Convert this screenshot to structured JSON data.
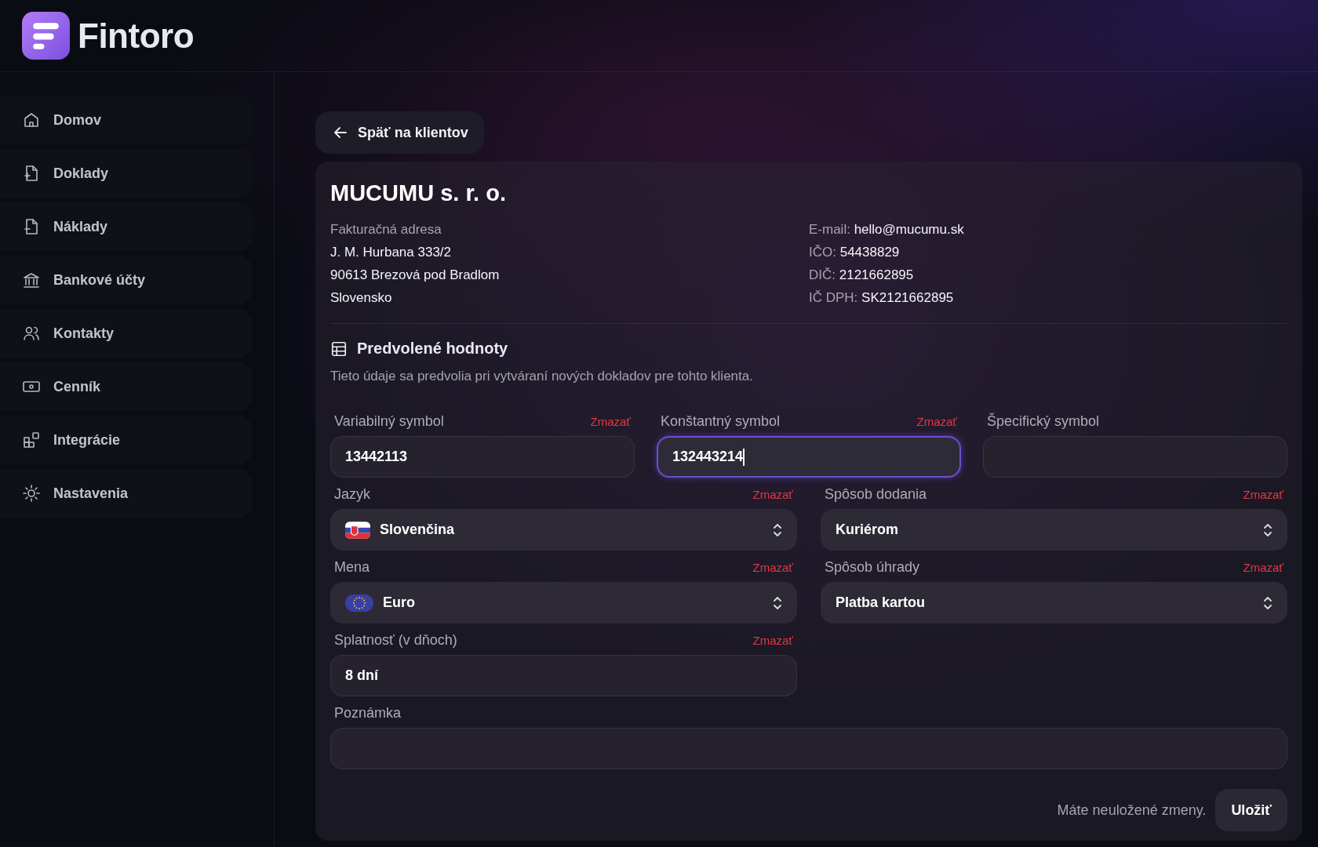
{
  "app": {
    "name": "Fintoro"
  },
  "sidebar": {
    "items": [
      {
        "label": "Domov"
      },
      {
        "label": "Doklady"
      },
      {
        "label": "Náklady"
      },
      {
        "label": "Bankové účty"
      },
      {
        "label": "Kontakty"
      },
      {
        "label": "Cenník"
      },
      {
        "label": "Integrácie"
      },
      {
        "label": "Nastavenia"
      }
    ]
  },
  "back_button": "Späť na klientov",
  "client": {
    "name": "MUCUMU s. r. o.",
    "address_label": "Fakturačná adresa",
    "address_lines": [
      "J. M. Hurbana 333/2",
      "90613 Brezová pod Bradlom",
      "Slovensko"
    ],
    "details": [
      {
        "label": "E-mail:",
        "value": "hello@mucumu.sk"
      },
      {
        "label": "IČO:",
        "value": "54438829"
      },
      {
        "label": "DIČ:",
        "value": "2121662895"
      },
      {
        "label": "IČ DPH:",
        "value": "SK2121662895"
      }
    ]
  },
  "defaults": {
    "title": "Predvolené hodnoty",
    "description": "Tieto údaje sa predvolia pri vytváraní nových dokladov pre tohto klienta.",
    "rows": [
      [
        {
          "label": "Variabilný symbol",
          "clear": "Zmazať",
          "kind": "text",
          "value": "13442113",
          "focused": false
        },
        {
          "label": "Konštantný symbol",
          "clear": "Zmazať",
          "kind": "text",
          "value": "132443214",
          "focused": true
        },
        {
          "label": "Špecifický symbol",
          "kind": "text",
          "focused": false
        }
      ],
      [
        {
          "label": "Jazyk",
          "clear": "Zmazať",
          "kind": "language-select",
          "value": "Slovenčina",
          "focused": false
        },
        {
          "label": "Spôsob dodania",
          "clear": "Zmazať",
          "kind": "select",
          "value": "Kuriérom",
          "focused": false
        }
      ],
      [
        {
          "label": "Mena",
          "clear": "Zmazať",
          "kind": "currency-select",
          "value": "Euro",
          "focused": false
        },
        {
          "label": "Spôsob úhrady",
          "clear": "Zmazať",
          "kind": "select",
          "value": "Platba kartou",
          "focused": false
        }
      ],
      [
        {
          "label": "Splatnosť (v dňoch)",
          "clear": "Zmazať",
          "kind": "text",
          "value": "8 dní",
          "focused": false
        }
      ],
      [
        {
          "label": "Poznámka",
          "kind": "note",
          "focused": false
        }
      ]
    ]
  },
  "footer": {
    "unsaved_note": "Máte neuložené zmeny.",
    "save_button": "Uložiť"
  }
}
